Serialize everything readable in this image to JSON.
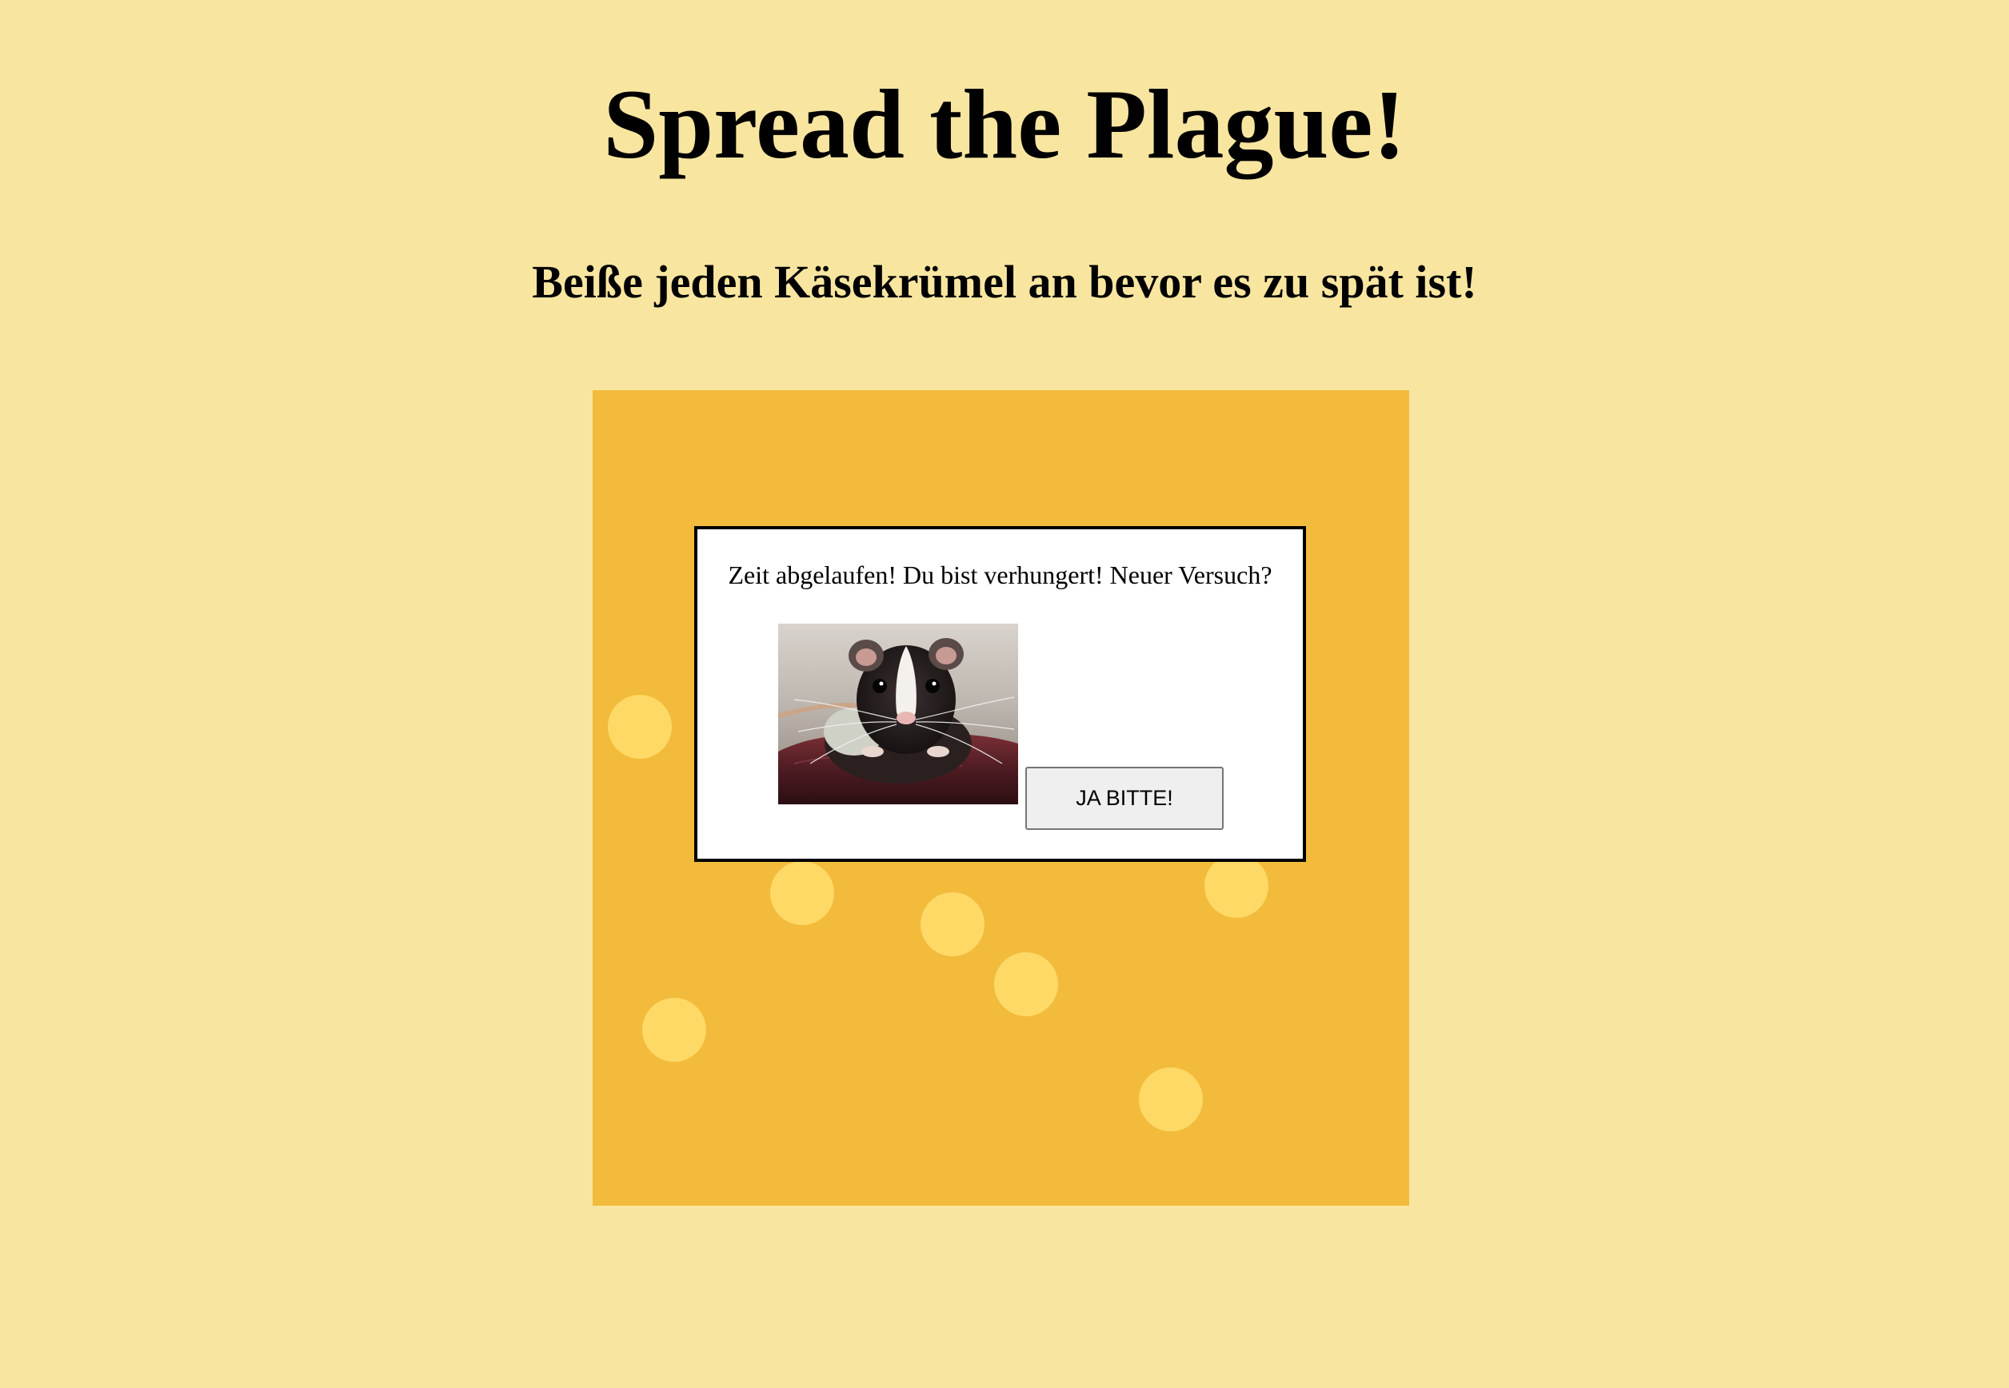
{
  "page": {
    "title": "Spread the Plague!",
    "subtitle": "Beiße jeden Käsekrümel an bevor es zu spät ist!"
  },
  "board": {
    "crumb_count": 7
  },
  "dialog": {
    "message": "Zeit abgelaufen! Du bist verhungert! Neuer Versuch?",
    "image": "rat-photo",
    "button_label": "JA BITTE!"
  },
  "colors": {
    "page_background": "#f8e6a0",
    "board_background": "#f2bb3b",
    "crumb": "#ffd966",
    "dialog_background": "#ffffff",
    "button_background": "#efefef"
  }
}
